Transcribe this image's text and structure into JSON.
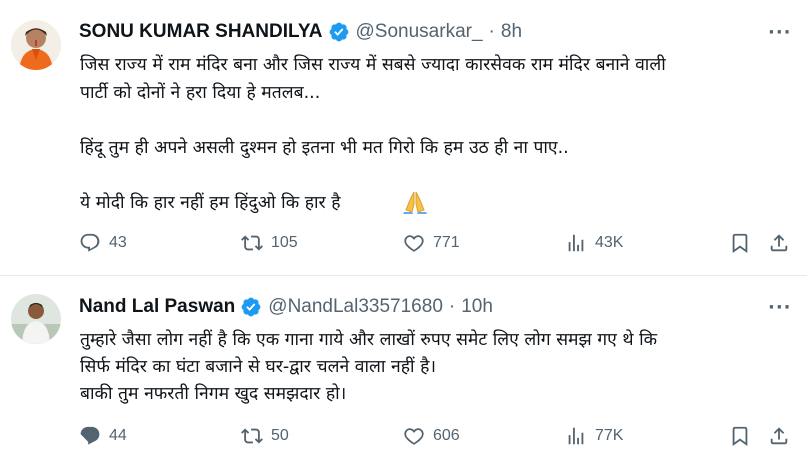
{
  "tweets": [
    {
      "name": "SONU KUMAR SHANDILYA",
      "handle": "@Sonusarkar_",
      "separator": "·",
      "time": "8h",
      "more": "···",
      "lines": [
        "जिस राज्य में राम मंदिर बना और जिस राज्य में सबसे ज्यादा कारसेवक राम मंदिर बनाने वाली",
        "पार्टी को दोनों ने हरा दिया हे मतलब...",
        "हिंदू तुम ही अपने असली दुश्मन हो इतना भी मत गिरो कि हम उठ ही ना पाए..",
        "ये मोदी कि हार नहीं हम हिंदुओ कि हार है"
      ],
      "emoji": "folded-hands-icon",
      "replies": "43",
      "reposts": "105",
      "likes": "771",
      "views": "43K"
    },
    {
      "name": "Nand Lal Paswan",
      "handle": "@NandLal33571680",
      "separator": "·",
      "time": "10h",
      "more": "···",
      "lines": [
        "तुम्हारे जैसा लोग नहीं है कि एक गाना गाये और लाखों रुपए समेट लिए लोग समझ गए थे कि",
        "सिर्फ मंदिर का घंटा बजाने से घर-द्वार चलने वाला नहीं है।",
        "बाकी तुम नफरती निगम खुद समझदार हो।"
      ],
      "replies": "44",
      "reposts": "50",
      "likes": "606",
      "views": "77K"
    }
  ],
  "colors": {
    "verified": "#1d9bf0",
    "text": "#0f1419",
    "secondary": "#536471"
  }
}
